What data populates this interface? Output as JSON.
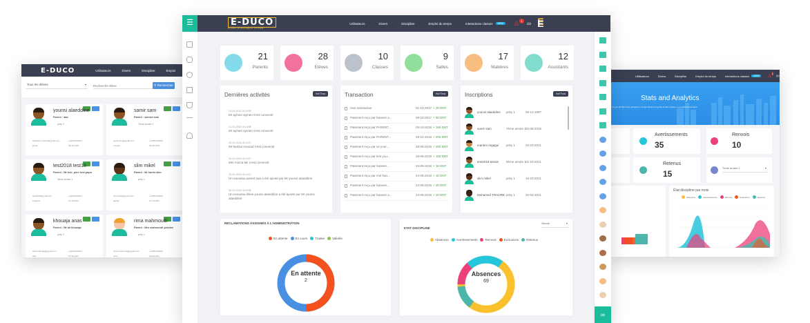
{
  "main": {
    "logo": "E-DUCO",
    "logo_sub": "GLOBAL MANAGEMENT SYSTEM",
    "nav": [
      "Utilisateurs",
      "Divers",
      "Discipline",
      "Emploi du temps",
      "Interactions classes"
    ],
    "nav_badge": "NEW",
    "notif_count": "1",
    "stats": [
      {
        "value": "21",
        "label": "Parents",
        "color": "#6fd3e6"
      },
      {
        "value": "28",
        "label": "Elèves",
        "color": "#ef5b8c"
      },
      {
        "value": "10",
        "label": "Classes",
        "color": "#b0b7c3"
      },
      {
        "value": "9",
        "label": "Salles",
        "color": "#7fd98c"
      },
      {
        "value": "17",
        "label": "Matières",
        "color": "#f6b26b"
      },
      {
        "value": "12",
        "label": "Assistants",
        "color": "#6bd6c6"
      }
    ],
    "activities": {
      "title": "Dernières activités",
      "btn": "Voir Tous",
      "items": [
        {
          "date": "14-10-2018 16:18:08",
          "text": "Mr aymen aymen s'est connecté"
        },
        {
          "date": "14-10-2018 16:13:08",
          "text": "Mr aymen aymen s'est connecté"
        },
        {
          "date": "10-10-2018 16:13:07",
          "text": "Mr bedoui mourad s'est connecté"
        },
        {
          "date": "10-10-2018 16:13:07",
          "text": "Mrs Amina Mir s'est connecté"
        },
        {
          "date": "10-10-2018 16:13:07",
          "text": "Un nouveau parent aaa a été ajouté par Mr younsi alaeddine"
        },
        {
          "date": "09-10-2018 16:13:08",
          "text": "Un nouveau élève younsi alaeddine a été ajouté par Mr younsi alaeddine"
        }
      ]
    },
    "transactions": {
      "title": "Transaction",
      "btn": "Voir Tous",
      "items": [
        {
          "text": "new transaction",
          "date": "01-10-2017",
          "amount": "+ 20 DNT"
        },
        {
          "text": "Paiement reçu par haneen a...",
          "date": "08-10-2017",
          "amount": "+ 50 DNT"
        },
        {
          "text": "Paiement reçu par PARENT...",
          "date": "03-10-2018",
          "amount": "+ 150 DNT"
        },
        {
          "text": "Paiement reçu par PARENT...",
          "date": "03-10-2018",
          "amount": "+ 200 DNT"
        },
        {
          "text": "Paiement reçu par ce your...",
          "date": "28-09-2018",
          "amount": "+ 200 DNT"
        },
        {
          "text": "Paiement reçu par test you...",
          "date": "28-09-2018",
          "amount": "+ 150 DNT"
        },
        {
          "text": "Paiement reçu par haneen...",
          "date": "24-09-2018",
          "amount": "+ 10 DNT"
        },
        {
          "text": "Paiement reçu par mol han...",
          "date": "24-09-2018",
          "amount": "+ 10 DNT"
        },
        {
          "text": "Paiement reçu par haneen...",
          "date": "24-09-2018",
          "amount": "+ 20 DNT"
        },
        {
          "text": "Paiement reçu par haneen a...",
          "date": "24-09-2018",
          "amount": "+ 20 DNT"
        }
      ]
    },
    "inscriptions": {
      "title": "Inscriptions",
      "btn": "Voir Tous",
      "items": [
        {
          "name": "younsi alaeddine",
          "cls": "prép 1",
          "date": "09-12-1997",
          "skin": "#a0522d"
        },
        {
          "name": "samir sam",
          "cls": "7ème année 2",
          "date": "02-08-2016",
          "skin": "#8d5524"
        },
        {
          "name": "mariem regaguí",
          "cls": "prép 1",
          "date": "20-10-2011",
          "skin": "#c68642"
        },
        {
          "name": "test2018 test18",
          "cls": "9ème année 1",
          "date": "01-10-2011",
          "skin": "#8d5524"
        },
        {
          "name": "slim mikel",
          "cls": "prép 1",
          "date": "10-10-2011",
          "skin": "#5c3317"
        },
        {
          "name": "Mohamed TRAORE",
          "cls": "prép 1",
          "date": "20-02-2011",
          "skin": "#3b2414"
        }
      ]
    },
    "reclamations": {
      "title": "RÉCLAMATIONS ASSIGNÉS À L'ADMINISTRATION",
      "legend": [
        {
          "label": "En attente",
          "color": "#f4511e"
        },
        {
          "label": "En cours",
          "color": "#4a90e2"
        },
        {
          "label": "Traitée",
          "color": "#26c6da"
        },
        {
          "label": "Validée",
          "color": "#8bc34a"
        }
      ],
      "center_label": "En attente",
      "center_value": "2"
    },
    "discipline": {
      "title": "ETAT DISCIPLINE",
      "select": "Skcole",
      "legend": [
        {
          "label": "Absences",
          "color": "#fbc02d"
        },
        {
          "label": "Avertissements",
          "color": "#26c6da"
        },
        {
          "label": "Renvois",
          "color": "#ec407a"
        },
        {
          "label": "Exclusions",
          "color": "#f4511e"
        },
        {
          "label": "Retenus",
          "color": "#4db6ac"
        }
      ],
      "center_label": "Absences",
      "center_value": "69"
    }
  },
  "left": {
    "logo": "E-DUCO",
    "nav": [
      "Utilisateurs",
      "Divers",
      "Discipline",
      "Emploi"
    ],
    "filter": "Tous les élèves",
    "search_placeholder": "Recherche élève",
    "search_btn": "Rechercher",
    "students": [
      {
        "name": "younsi alaeddine",
        "parent": "Parent : aaa",
        "cls": "prép 1",
        "email": "alaeddine.younsi@gmail.com",
        "phone": "+21651234567",
        "birth": "09-12-1997",
        "city": "jelma",
        "skin": "#8d5524",
        "gender": "m"
      },
      {
        "name": "samir sam",
        "parent": "Parent : samira sam",
        "cls": "7ème année 2",
        "email": "samir.sam@gmail.com",
        "phone": "+21651234567",
        "birth": "02-08-2016",
        "city": "Tunisia",
        "skin": "#8d5524",
        "gender": "m"
      },
      {
        "name": "test2018 test18",
        "parent": "Parent : Mr test_père test-papa",
        "cls": "9ème année 1",
        "email": "test2018@gmail.com",
        "phone": "+21651234567",
        "birth": "01-10-2011",
        "city": "indigene",
        "skin": "#8d5524",
        "gender": "m"
      },
      {
        "name": "slim mikel",
        "parent": "Parent : Mr karim slim",
        "cls": "prép 1",
        "email": "slim.mikel@gmail.com",
        "phone": "+21651234567",
        "birth": "10-10-2011",
        "city": "djerba",
        "skin": "#5c3317",
        "gender": "m"
      },
      {
        "name": "khouaja anas",
        "parent": "Parent : Mr ali khouaja",
        "cls": "prép 1",
        "email": "anas.khouaja@gmail.com",
        "phone": "+21651234567",
        "birth": "20-11-2011",
        "city": "sfax",
        "skin": "#8d5524",
        "gender": "m"
      },
      {
        "name": "rima mahmoudi",
        "parent": "Parent : Mrs mahmoudi yassine",
        "cls": "prép 1",
        "email": "rima.mahmoudi@gmail.com",
        "phone": "+21651234567",
        "birth": "20-03-2011",
        "city": "tunis",
        "skin": "#f5c6a5",
        "gender": "f"
      }
    ]
  },
  "right": {
    "nav": [
      "Utilisateurs",
      "Divers",
      "Discipline",
      "Emploi du temps",
      "Interactions classes"
    ],
    "badge": "NEW",
    "notif": "1",
    "banner_title": "Stats and Analytics",
    "banner_text": "Le prix du 500 vous présente Lors des absences gérés à votre classe ou pendant la semaine.",
    "cards": [
      {
        "label": "Avertissements",
        "value": "35",
        "color": "#26c6da"
      },
      {
        "label": "Renvois",
        "value": "10",
        "color": "#ec407a"
      },
      {
        "label": "Retenus",
        "value": "15",
        "color": "#4db6ac"
      }
    ],
    "select": "7ème année 2",
    "chart_title": "État discipline par mois",
    "chart_legend": [
      {
        "label": "Absences",
        "color": "#fbc02d"
      },
      {
        "label": "Avertissements",
        "color": "#26c6da"
      },
      {
        "label": "Renvois",
        "color": "#ec407a"
      },
      {
        "label": "Exclusions",
        "color": "#f4511e"
      },
      {
        "label": "Retenus",
        "color": "#4db6ac"
      }
    ]
  }
}
